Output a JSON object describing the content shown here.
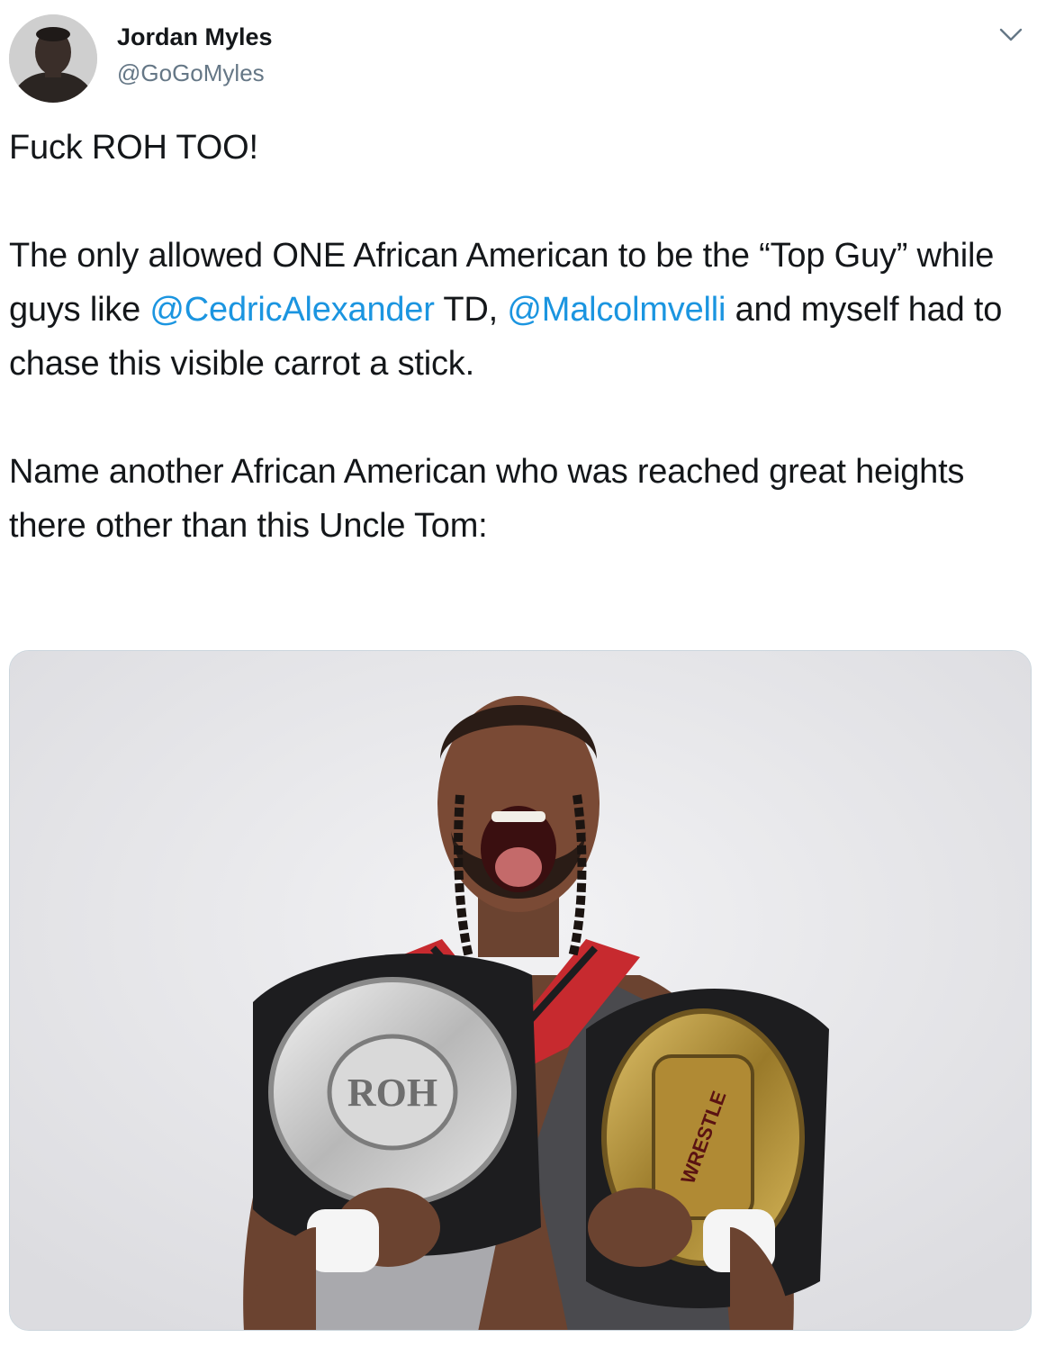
{
  "tweet": {
    "author": {
      "name": "Jordan Myles",
      "handle": "@GoGoMyles",
      "avatar_icon": "avatar-photo"
    },
    "more_icon": "chevron-down-icon",
    "paragraphs": [
      {
        "segments": [
          {
            "text": "Fuck ROH TOO!",
            "type": "text"
          }
        ]
      },
      {
        "segments": [
          {
            "text": "The only allowed ONE African American to be the “Top Guy” while guys like ",
            "type": "text"
          },
          {
            "text": "@CedricAlexander",
            "type": "mention"
          },
          {
            "text": " TD, ",
            "type": "text"
          },
          {
            "text": "@Malcolmvelli",
            "type": "mention"
          },
          {
            "text": " and myself had to chase this visible carrot a stick.",
            "type": "text"
          }
        ]
      },
      {
        "segments": [
          {
            "text": "Name another African American who was reached great heights there other than this Uncle Tom:",
            "type": "text"
          }
        ]
      }
    ],
    "media": {
      "type": "photo",
      "subject": "wrestler holding two championship belts",
      "belt_left_text": "ROH",
      "belt_right_text": "WRESTLE",
      "background_color": "#e8e8ea"
    },
    "colors": {
      "text": "#14171a",
      "secondary": "#657786",
      "mention": "#1b95e0",
      "border": "#ccd6dd"
    }
  }
}
